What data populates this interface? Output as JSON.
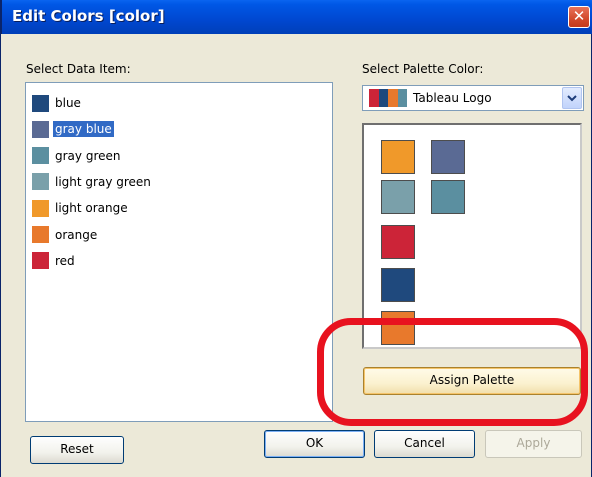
{
  "window": {
    "title": "Edit Colors [color]",
    "close_symbol": "✕"
  },
  "data_items": {
    "label": "Select Data Item:",
    "selected_index": 1,
    "items": [
      {
        "label": "blue",
        "color": "#1f497d"
      },
      {
        "label": "gray blue",
        "color": "#5a6a94"
      },
      {
        "label": "gray green",
        "color": "#5b8fa0"
      },
      {
        "label": "light gray green",
        "color": "#7aa0aa"
      },
      {
        "label": "light orange",
        "color": "#f0992a"
      },
      {
        "label": "orange",
        "color": "#e8792c"
      },
      {
        "label": "red",
        "color": "#cc2438"
      }
    ]
  },
  "palette": {
    "label": "Select Palette Color:",
    "selected": "Tableau Logo",
    "icon_colors": [
      "#cc2438",
      "#1f497d",
      "#e8792c",
      "#5b8fa0"
    ],
    "swatches": [
      {
        "color": "#f0992a"
      },
      {
        "color": "#5a6a94"
      },
      {
        "color": "#7aa0aa"
      },
      {
        "color": "#5b8fa0"
      },
      {
        "color": "#cc2438"
      },
      {
        "color": "#1f497d"
      },
      {
        "color": "#e8792c"
      }
    ]
  },
  "buttons": {
    "assign_palette": "Assign Palette",
    "reset": "Reset",
    "ok": "OK",
    "cancel": "Cancel",
    "apply": "Apply"
  },
  "annotation": {
    "ring_color": "#e8121f"
  }
}
